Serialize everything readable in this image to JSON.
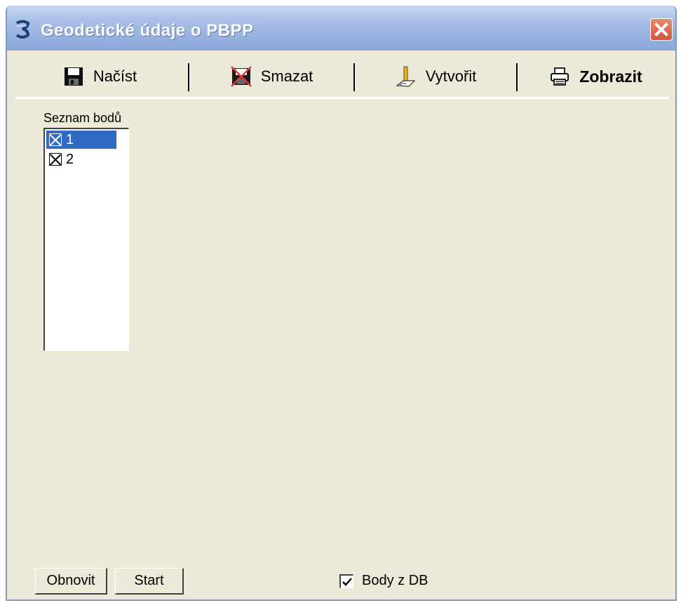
{
  "window": {
    "title": "Geodetické údaje o PBPP",
    "close_icon": "close-icon"
  },
  "tabs": [
    {
      "label": "Načíst",
      "icon": "floppy-disk-icon",
      "active": false
    },
    {
      "label": "Smazat",
      "icon": "delete-floppy-icon",
      "active": false
    },
    {
      "label": "Vytvořit",
      "icon": "pen-pencil-icon",
      "active": false
    },
    {
      "label": "Zobrazit",
      "icon": "printer-icon",
      "active": true
    }
  ],
  "points_list": {
    "label": "Seznam bodů",
    "items": [
      {
        "label": "1",
        "checked": true,
        "selected": true
      },
      {
        "label": "2",
        "checked": true,
        "selected": false
      }
    ]
  },
  "footer": {
    "refresh_label": "Obnovit",
    "start_label": "Start",
    "db_checkbox_label": "Body z DB",
    "db_checkbox_checked": true
  },
  "colors": {
    "title_bar": "#96b0df",
    "dialog_bg": "#ece9d8",
    "selection": "#316ac5",
    "close_button": "#d0573b"
  }
}
